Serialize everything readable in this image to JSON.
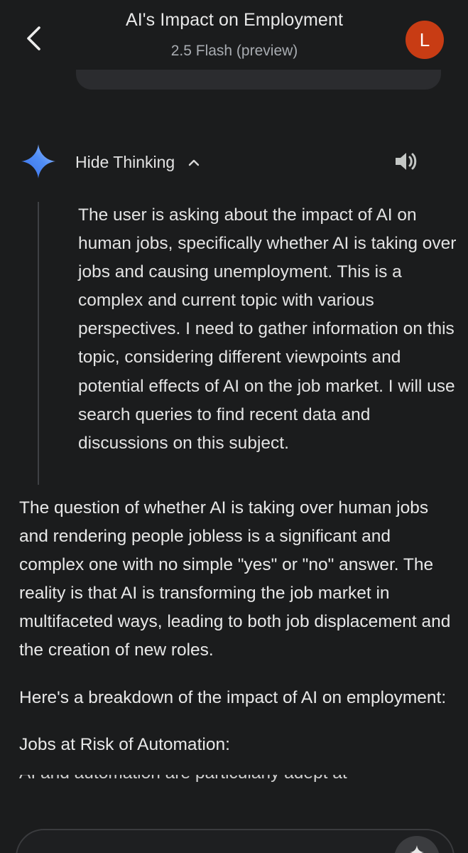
{
  "header": {
    "title": "AI's Impact on Employment",
    "model": "2.5 Flash (preview)",
    "avatar_initial": "L",
    "avatar_color": "#c83c14"
  },
  "thinking": {
    "toggle_label": "Hide Thinking",
    "text": "The user is asking about the impact of AI on human jobs, specifically whether AI is taking over jobs and causing unemployment. This is a complex and current topic with various perspectives. I need to gather information on this topic, considering different viewpoints and potential effects of AI on the job market. I will use search queries to find recent data and discussions on this subject."
  },
  "response": {
    "paragraphs": [
      "The question of whether AI is taking over human jobs and rendering people jobless is a significant and complex one with no simple \"yes\" or \"no\" answer. The reality is that AI is transforming the job market in multifaceted ways, leading to both job displacement and the creation of new roles.",
      "Here's a breakdown of the impact of AI on employment:",
      "Jobs at Risk of Automation:",
      "AI and automation are particularly adept at"
    ]
  },
  "icons": {
    "back": "arrow-back-icon",
    "gemini": "gemini-sparkle-icon",
    "chevron": "chevron-up-icon",
    "speaker": "speaker-icon",
    "input_action": "sparkle-icon"
  },
  "colors": {
    "background": "#1b1c1d",
    "text": "#e3e3e3",
    "muted": "#a8acb1"
  }
}
